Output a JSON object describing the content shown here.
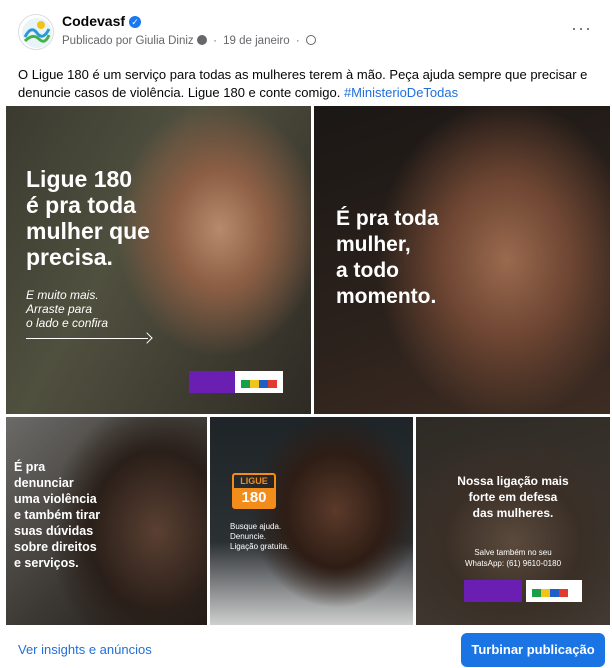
{
  "post": {
    "author": "Codevasf",
    "published_by": "Publicado por Giulia Diniz",
    "date": "19 de janeiro",
    "text": "O Ligue 180 é um serviço para todas as mulheres terem à mão. Peça ajuda sempre que precisar e denuncie casos de violência. Ligue 180 e conte comigo.",
    "hashtag": "#MinisterioDeTodas",
    "icons": [
      "verified-badge-icon",
      "info-icon",
      "globe-icon",
      "more-options-icon"
    ]
  },
  "gallery": {
    "tile1": {
      "headline_lines": [
        "Ligue 180",
        "é pra toda",
        "mulher que",
        "precisa."
      ],
      "sub_lines": [
        "E muito mais.",
        "Arraste para",
        "o lado e confira"
      ]
    },
    "tile2": {
      "headline_lines": [
        "É pra toda",
        "mulher,",
        "a todo",
        "momento."
      ]
    },
    "tile3": {
      "text_lines": [
        "É pra",
        "denunciar",
        "uma violência",
        "e também tirar",
        "suas dúvidas",
        "sobre direitos",
        "e serviços."
      ]
    },
    "tile4": {
      "ligue_label": "LIGUE",
      "ligue_number": "180",
      "info_lines": [
        "Busque ajuda.",
        "Denuncie.",
        "Ligação gratuita."
      ]
    },
    "tile5": {
      "headline_lines": [
        "Nossa ligação mais",
        "forte em defesa",
        "das mulheres."
      ],
      "whatsapp_lines": [
        "Salve também no seu",
        "WhatsApp: (61) 9610-0180"
      ]
    }
  },
  "footer": {
    "insights_label": "Ver insights e anúncios",
    "boost_label": "Turbinar publicação"
  },
  "colors": {
    "link_blue": "#216fdb",
    "button_blue": "#1b74e4",
    "ministry_purple": "#6a1fb2",
    "ligue_orange": "#f28c1a"
  }
}
